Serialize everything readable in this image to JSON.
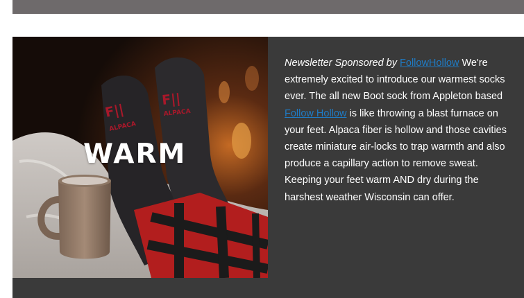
{
  "hero": {
    "overlay_word": "WARM",
    "sock_print": "F||",
    "sock_print_secondary": "ALPACA"
  },
  "newsletter": {
    "sponsor_prefix": "Newsletter Sponsored by ",
    "sponsor_link": "FollowHollow",
    "body_part1": " We're extremely excited to introduce our warmest socks ever. The all new Boot sock from Appleton based ",
    "body_link": "Follow Hollow",
    "body_part2": " is like throwing a blast furnace on your feet. Alpaca fiber is hollow and those cavities create miniature air-locks to trap warmth and also produce a capillary action to remove sweat. Keeping your feet warm AND dry during the harshest weather Wisconsin can offer."
  },
  "colors": {
    "top_bar": "#6e6a6b",
    "panel_bg": "#3a3a3a",
    "link": "#1f7bc4",
    "text": "#ffffff"
  }
}
